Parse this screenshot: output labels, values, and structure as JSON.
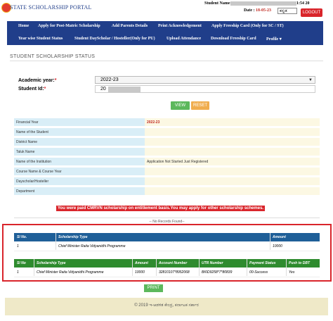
{
  "header": {
    "portal_title": "STATE SCHOLARSHIP PORTAL",
    "user_label": "Student Name",
    "user_tail": "1:54 20",
    "date_label": "Date : ",
    "date_value": "18-05-23",
    "language": "ಕನ್ನಡ",
    "logout": "LOGOUT"
  },
  "nav": {
    "items": [
      "Home",
      "Apply for Post-Matric Scholarship",
      "Add Parents Details",
      "Print Acknowledgement",
      "Apply Freeship Card (Only for SC / ST)",
      "Year wise Student Status",
      "Student DayScholar / Hosteller(Only for PU)",
      "Upload Attendance",
      "Download Freeship Card",
      "Profile ▾"
    ]
  },
  "page": {
    "section_title": "STUDENT SCHOLARSHIP STATUS"
  },
  "form": {
    "academic_year_label": "Academic year:",
    "academic_year_value": "2022-23",
    "student_id_label": "Student Id:",
    "student_id_value": "20",
    "view_button": "VIEW",
    "reset_button": "RESET"
  },
  "info": {
    "rows": [
      {
        "label": "Financial Year",
        "value": "2022-23"
      },
      {
        "label": "Name of the Student",
        "value": ""
      },
      {
        "label": "District Name",
        "value": ""
      },
      {
        "label": "Taluk Name",
        "value": ""
      },
      {
        "label": "Name of the Institution",
        "value": "Application Not Started Just Registered"
      },
      {
        "label": "Course Name & Course Year",
        "value": ""
      },
      {
        "label": "Dayscholar/Hosteller",
        "value": ""
      },
      {
        "label": "Department",
        "value": ""
      }
    ]
  },
  "notice": "You were paid CMRVN scholarship on entitlement basis.You may apply for other scholarship schemes.",
  "no_records": "-- No Records Found--",
  "scholarship_table": {
    "headers": [
      "Sl No.",
      "Scholarship Type",
      "Amount"
    ],
    "rows": [
      [
        "1",
        "Chief Minister Raita Vidyanidhi Programme",
        "10000"
      ]
    ]
  },
  "payment_table": {
    "headers": [
      "Sl No",
      "Scholarship Type",
      "Amount",
      "Account Number",
      "UTR Number",
      "Payment Status",
      "Push to DBT"
    ],
    "rows": [
      [
        "1",
        "Chief Minister Raita Vidyanidhi Programme",
        "10000",
        "32810107*8952068",
        "BKID9258*7*80839",
        "00-Success",
        "Yes"
      ]
    ]
  },
  "print_button": "PRINT",
  "footer": "© 2019 ಇ-ಆಡಳಿತ ಕೇಂದ್ರ, ಕರ್ನಾಟಕ ಸರ್ಕಾರ"
}
